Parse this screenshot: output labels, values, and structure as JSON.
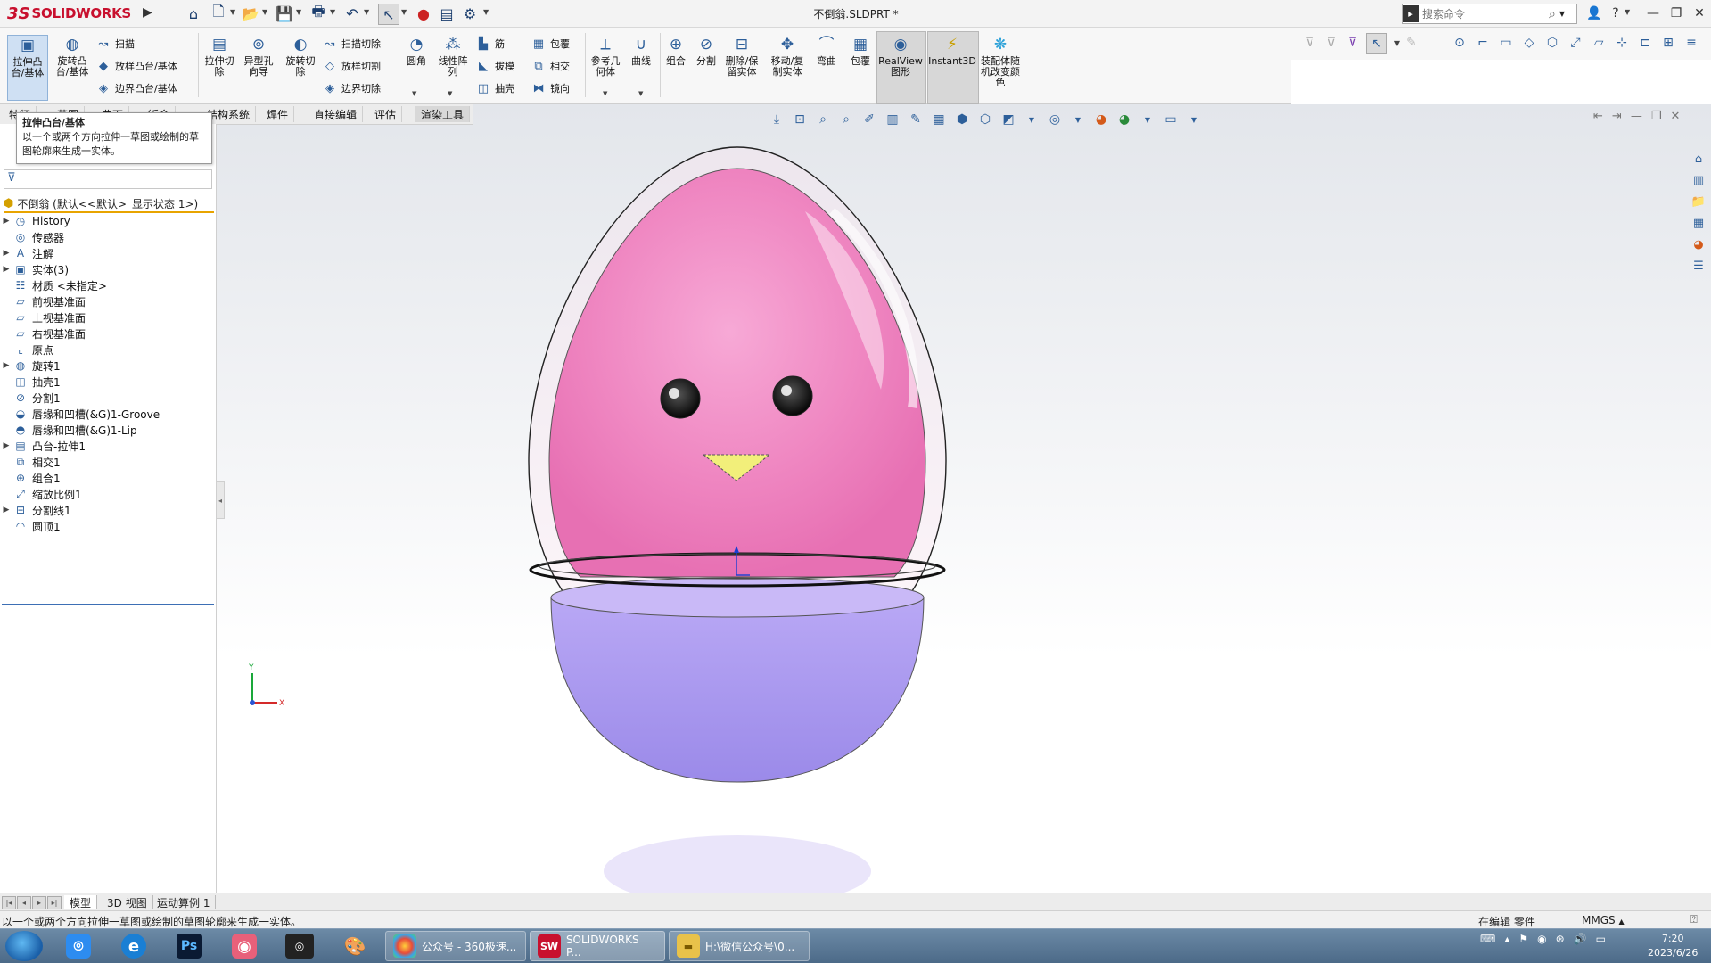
{
  "app": {
    "logo_ds": "3S",
    "logo_text": "SOLIDWORKS",
    "doc_title": "不倒翁.SLDPRT *",
    "search_placeholder": "搜索命令"
  },
  "ribbon": {
    "extrude_boss": "拉伸凸台/基体",
    "revolve_boss": "旋转凸台/基体",
    "sweep": "扫描",
    "loft_boss": "放样凸台/基体",
    "boundary_boss": "边界凸台/基体",
    "extrude_cut": "拉伸切除",
    "hole_wizard": "异型孔向导",
    "revolve_cut": "旋转切除",
    "swept_cut": "扫描切除",
    "lofted_cut": "放样切割",
    "boundary_cut": "边界切除",
    "fillet": "圆角",
    "linear_pattern": "线性阵列",
    "rib": "筋",
    "draft": "拔模",
    "shell": "抽壳",
    "wrap": "包覆",
    "intersect": "相交",
    "mirror": "镜向",
    "ref_geometry": "参考几何体",
    "curves": "曲线",
    "combine": "组合",
    "split": "分割",
    "delete_keep_body": "删除/保留实体",
    "move_copy_body": "移动/复制实体",
    "flex": "弯曲",
    "wrap2": "包覆",
    "realview": "RealView图形",
    "instant3d": "Instant3D",
    "random_color": "装配体随机改变颜色"
  },
  "tabs": [
    "特征",
    "草图",
    "曲面",
    "钣金",
    "结构系统",
    "焊件",
    "直接编辑",
    "评估",
    "渲染工具"
  ],
  "tooltip": {
    "title": "拉伸凸台/基体",
    "body": "以一个或两个方向拉伸一草图或绘制的草图轮廓来生成一实体。"
  },
  "tree": {
    "root": "不倒翁  (默认<<默认>_显示状态 1>)",
    "items": [
      {
        "label": "History",
        "icon": "history-icon",
        "arrow": true
      },
      {
        "label": "传感器",
        "icon": "sensor-icon",
        "arrow": false
      },
      {
        "label": "注解",
        "icon": "annotation-icon",
        "arrow": true
      },
      {
        "label": "实体(3)",
        "icon": "solid-bodies-icon",
        "arrow": true
      },
      {
        "label": "材质 <未指定>",
        "icon": "material-icon",
        "arrow": false
      },
      {
        "label": "前视基准面",
        "icon": "plane-icon",
        "arrow": false
      },
      {
        "label": "上视基准面",
        "icon": "plane-icon",
        "arrow": false
      },
      {
        "label": "右视基准面",
        "icon": "plane-icon",
        "arrow": false
      },
      {
        "label": "原点",
        "icon": "origin-icon",
        "arrow": false
      },
      {
        "label": "旋转1",
        "icon": "revolve-icon",
        "arrow": true
      },
      {
        "label": "抽壳1",
        "icon": "shell-icon",
        "arrow": false
      },
      {
        "label": "分割1",
        "icon": "split-icon",
        "arrow": false
      },
      {
        "label": "唇缘和凹槽(&G)1-Groove",
        "icon": "groove-icon",
        "arrow": false
      },
      {
        "label": "唇缘和凹槽(&G)1-Lip",
        "icon": "lip-icon",
        "arrow": false
      },
      {
        "label": "凸台-拉伸1",
        "icon": "extrude-icon",
        "arrow": true
      },
      {
        "label": "相交1",
        "icon": "intersect-icon",
        "arrow": false
      },
      {
        "label": "组合1",
        "icon": "combine-icon",
        "arrow": false
      },
      {
        "label": "缩放比例1",
        "icon": "scale-icon",
        "arrow": false
      },
      {
        "label": "分割线1",
        "icon": "split-line-icon",
        "arrow": true
      },
      {
        "label": "圆顶1",
        "icon": "dome-icon",
        "arrow": false
      }
    ]
  },
  "bottom_tabs": [
    "模型",
    "3D 视图",
    "运动算例 1"
  ],
  "status": {
    "hint": "以一个或两个方向拉伸一草图或绘制的草图轮廓来生成一实体。",
    "mode": "在编辑 零件",
    "units": "MMGS"
  },
  "taskbar": {
    "ps_label": "Ps",
    "app1": "公众号 - 360极速...",
    "app2": "SOLIDWORKS P...",
    "app2_icon": "SW",
    "app3": "H:\\微信公众号\\0...",
    "time": "7:20",
    "date": "2023/6/26"
  },
  "triad": {
    "x": "X",
    "y": "Y"
  },
  "colors": {
    "egg_pink": "#f28bc6",
    "egg_base": "#a99bf0",
    "beak": "#f2ef7a",
    "brand_red": "#c8102e",
    "accent_blue": "#2d5f9a"
  }
}
